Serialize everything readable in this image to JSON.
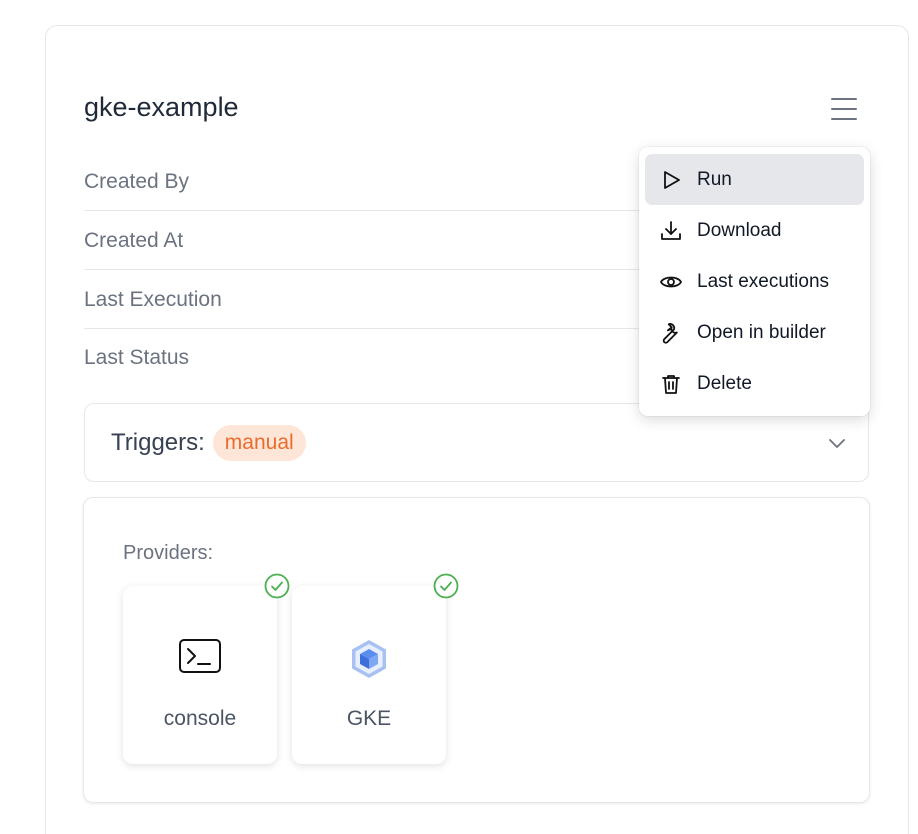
{
  "workflow": {
    "title": "gke-example"
  },
  "meta": {
    "created_by_label": "Created By",
    "created_at_label": "Created At",
    "last_execution_label": "Last Execution",
    "last_status_label": "Last Status"
  },
  "triggers": {
    "label": "Triggers:",
    "badges": [
      "manual"
    ]
  },
  "providers": {
    "label": "Providers:",
    "items": [
      {
        "name": "console",
        "icon": "terminal-icon",
        "connected": true
      },
      {
        "name": "GKE",
        "icon": "gke-icon",
        "connected": true
      }
    ]
  },
  "menu": {
    "items": [
      {
        "label": "Run",
        "icon": "play-icon",
        "active": true
      },
      {
        "label": "Download",
        "icon": "download-icon"
      },
      {
        "label": "Last executions",
        "icon": "eye-icon"
      },
      {
        "label": "Open in builder",
        "icon": "wrench-icon"
      },
      {
        "label": "Delete",
        "icon": "trash-icon"
      }
    ]
  },
  "colors": {
    "badge_bg": "#fde6d8",
    "badge_text": "#ea6c2c",
    "check_green": "#4caf50",
    "active_item_bg": "#e5e7eb"
  }
}
